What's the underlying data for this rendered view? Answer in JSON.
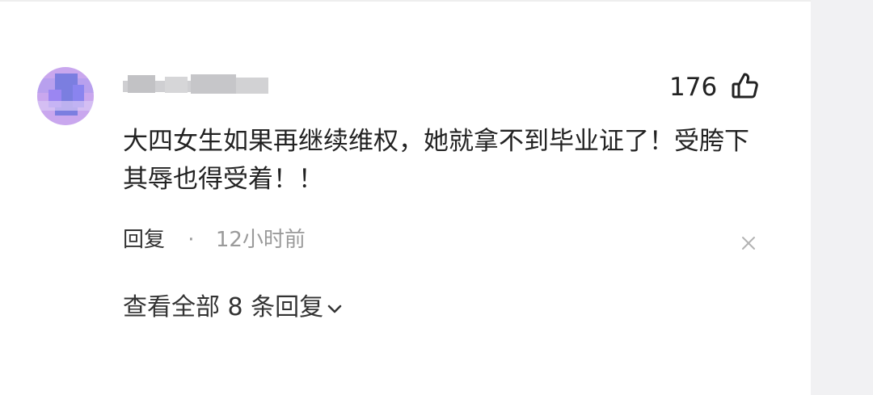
{
  "comment": {
    "username": "",
    "like_count": "176",
    "text": "大四女生如果再继续维权，她就拿不到毕业证了！受胯下其辱也得受着！！",
    "reply_label": "回复",
    "separator": "·",
    "time_ago": "12小时前",
    "view_replies_label": "查看全部 8 条回复"
  },
  "icons": {
    "like": "thumbs-up-icon",
    "close": "close-icon",
    "expand": "chevron-down-icon"
  },
  "colors": {
    "avatar_bg": "#c9a7ee",
    "avatar_pixel": "#7b7ee0",
    "text": "#222222",
    "muted": "#9a9a9a",
    "side_panel": "#f1f1f3"
  }
}
